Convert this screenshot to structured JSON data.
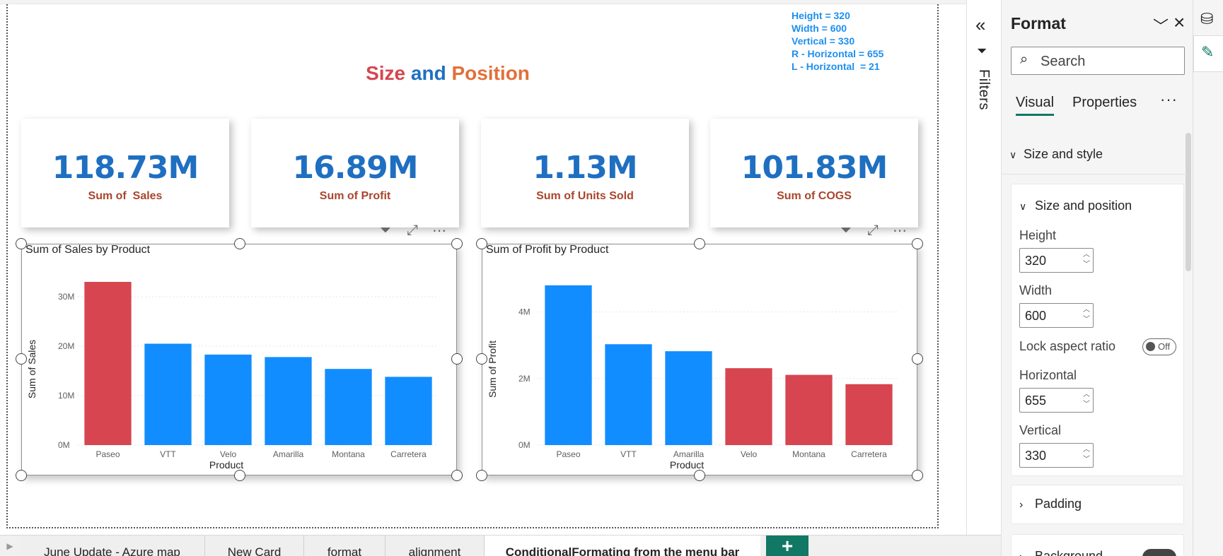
{
  "report": {
    "title_part1": "Size",
    "title_part2": "and",
    "title_part3": "Position",
    "notes": [
      "Height = 320",
      "Width = 600",
      "",
      "Vertical = 330",
      "",
      "R - Horizontal = 655",
      "L - Horizontal  = 21"
    ]
  },
  "cards": [
    {
      "value": "118.73M",
      "label": "Sum of  Sales"
    },
    {
      "value": "16.89M",
      "label": "Sum of Profit"
    },
    {
      "value": "1.13M",
      "label": "Sum of Units Sold"
    },
    {
      "value": "101.83M",
      "label": "Sum of COGS"
    }
  ],
  "visual_tools": {
    "filter_icon": "filter-icon",
    "focus_icon": "focus-mode-icon",
    "more_icon": "more-options-icon"
  },
  "chart_data": [
    {
      "type": "bar",
      "title": "Sum of Sales by Product",
      "xlabel": "Product",
      "ylabel": "Sum of Sales",
      "categories": [
        "Paseo",
        "VTT",
        "Velo",
        "Amarilla",
        "Montana",
        "Carretera"
      ],
      "values": [
        33.0,
        20.5,
        18.3,
        17.8,
        15.4,
        13.8
      ],
      "unit": "M",
      "yticks": [
        "0M",
        "10M",
        "20M",
        "30M"
      ],
      "ytick_values": [
        0,
        10,
        20,
        30
      ],
      "ylim": [
        0,
        35
      ],
      "colors": [
        "#d64550",
        "#118dff",
        "#118dff",
        "#118dff",
        "#118dff",
        "#118dff"
      ],
      "grid": true
    },
    {
      "type": "bar",
      "title": "Sum of Profit by Product",
      "xlabel": "Product",
      "ylabel": "Sum of Profit",
      "categories": [
        "Paseo",
        "VTT",
        "Amarilla",
        "Velo",
        "Montana",
        "Carretera"
      ],
      "values": [
        4.8,
        3.03,
        2.82,
        2.31,
        2.11,
        1.83
      ],
      "unit": "M",
      "yticks": [
        "0M",
        "2M",
        "4M"
      ],
      "ytick_values": [
        0,
        2,
        4
      ],
      "ylim": [
        0,
        5.2
      ],
      "colors": [
        "#118dff",
        "#118dff",
        "#118dff",
        "#d64550",
        "#d64550",
        "#d64550"
      ],
      "grid": true
    }
  ],
  "page_tabs": [
    {
      "label": "June Update - Azure map"
    },
    {
      "label": "New Card"
    },
    {
      "label": "format"
    },
    {
      "label": "alignment"
    },
    {
      "label": "ConditionalFormating from the menu bar"
    }
  ],
  "add_page_label": "+",
  "filters": {
    "label": "Filters",
    "collapse_icon": "«"
  },
  "format_pane": {
    "title": "Format",
    "search_placeholder": "Search",
    "tab_visual": "Visual",
    "tab_properties": "Properties",
    "more": "···",
    "section_size_style": "Size and style",
    "group_size_position": "Size and position",
    "height_label": "Height",
    "height_value": "320",
    "width_label": "Width",
    "width_value": "600",
    "lock_label": "Lock aspect ratio",
    "lock_state": "Off",
    "horizontal_label": "Horizontal",
    "horizontal_value": "655",
    "vertical_label": "Vertical",
    "vertical_value": "330",
    "padding_label": "Padding",
    "background_label": "Background"
  }
}
